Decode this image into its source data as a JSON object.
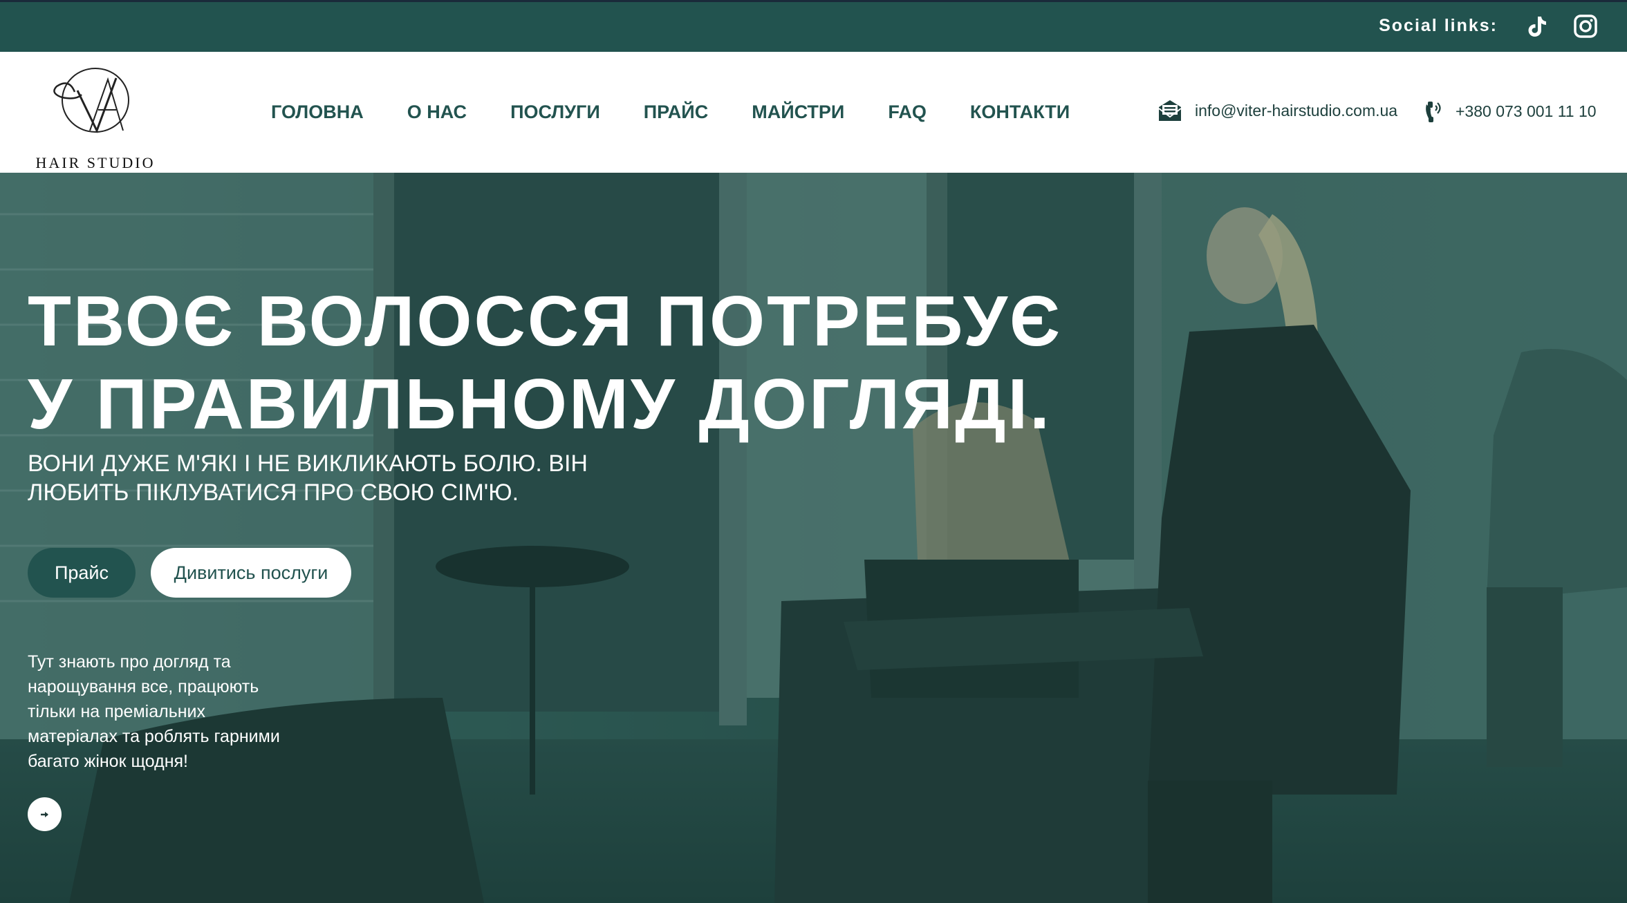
{
  "topbar": {
    "social_label": "Social links:",
    "icons": [
      "tiktok-icon",
      "instagram-icon"
    ]
  },
  "header": {
    "logo_text": "HAIR STUDIO",
    "nav": [
      "ГОЛОВНА",
      "О НАС",
      "ПОСЛУГИ",
      "ПРАЙС",
      "МАЙСТРИ",
      "FAQ",
      "КОНТАКТИ"
    ],
    "email": "info@viter-hairstudio.com.ua",
    "phone": "+380 073 001 11 10"
  },
  "hero": {
    "title_line1": "ТВОЄ ВОЛОССЯ ПОТРЕБУЄ",
    "title_line2": "У ПРАВИЛЬНОМУ ДОГЛЯДІ.",
    "subtitle": "ВОНИ ДУЖЕ М'ЯКІ І НЕ ВИКЛИКАЮТЬ БОЛЮ. ВІН ЛЮБИТЬ ПІКЛУВАТИСЯ ПРО СВОЮ СІМ'Ю.",
    "btn_price": "Прайс",
    "btn_services": "Дивитись послуги",
    "description": "Тут знають про догляд та нарощування все, працюють тільки на преміальних матеріалах та роблять гарними багато жінок щодня!"
  },
  "colors": {
    "brand": "#22534f",
    "topbar": "#22534f",
    "white": "#ffffff"
  }
}
